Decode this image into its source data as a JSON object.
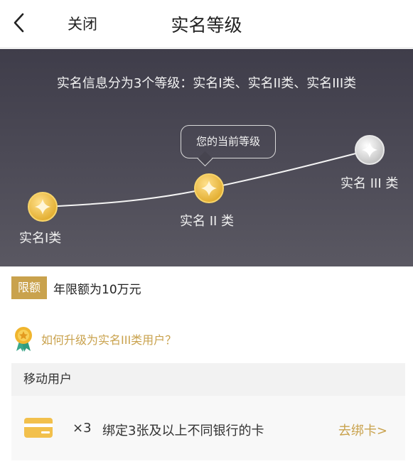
{
  "nav": {
    "close_label": "关闭",
    "title": "实名等级"
  },
  "hero": {
    "intro": "实名信息分为3个等级：实名I类、实名II类、实名III类",
    "levels": [
      {
        "label": "实名I类",
        "state": "achieved",
        "color": "#f0c24a"
      },
      {
        "label": "实名 II 类",
        "state": "current",
        "color": "#f0c24a"
      },
      {
        "label": "实名 III 类",
        "state": "locked",
        "color": "#d8d8d8"
      }
    ],
    "current_bubble": "您的当前等级"
  },
  "limit": {
    "tag": "限额",
    "text": "年限额为10万元"
  },
  "upgrade": {
    "text": "如何升级为实名III类用户？"
  },
  "section": {
    "title": "移动用户",
    "row": {
      "multiplier": "×3",
      "description": "绑定3张及以上不同银行的卡",
      "link": "去绑卡>"
    }
  },
  "colors": {
    "accent_gold": "#c9a24d",
    "hero_bg": "#46444f"
  },
  "icons": [
    "back-arrow-icon",
    "star-coin-icon",
    "medal-icon",
    "bank-card-icon"
  ]
}
